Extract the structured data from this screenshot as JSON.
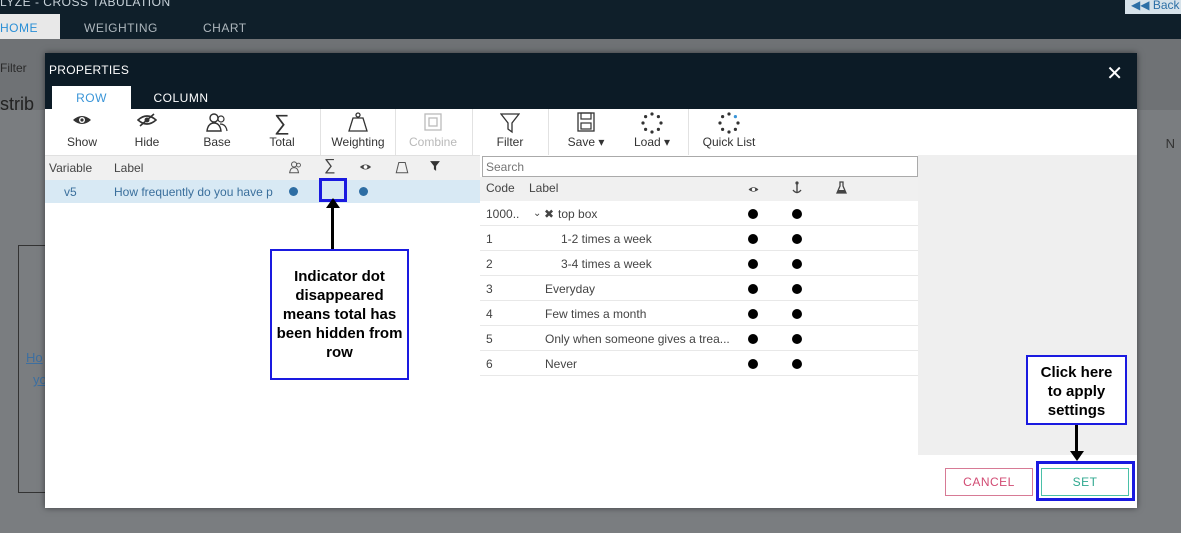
{
  "app": {
    "title": "LYZE - CROSS TABULATION",
    "back_label": "Back",
    "tabs": [
      "HOME",
      "WEIGHTING",
      "CHART"
    ],
    "ribbon_filter_label": "Filter",
    "sheet_text": "strib",
    "sheet_link_1": "Ho",
    "sheet_link_2": "yo",
    "sheet_col_label": "N"
  },
  "modal": {
    "title": "PROPERTIES",
    "close_symbol": "✕",
    "tabs": {
      "row": "ROW",
      "column": "COLUMN"
    },
    "toolbar": {
      "show": "Show",
      "hide": "Hide",
      "base": "Base",
      "total": "Total",
      "weighting": "Weighting",
      "combine": "Combine",
      "filter": "Filter",
      "save": "Save ▾",
      "load": "Load ▾",
      "quick_list": "Quick List"
    },
    "left_table": {
      "headers": {
        "variable": "Variable",
        "label": "Label"
      },
      "row": {
        "variable": "v5",
        "label": "How frequently do you have p"
      }
    },
    "right_table": {
      "search_placeholder": "Search",
      "headers": {
        "code": "Code",
        "label": "Label"
      },
      "rows": [
        {
          "code": "1000..",
          "label": "top box",
          "group": true
        },
        {
          "code": "1",
          "label": "1-2 times a week"
        },
        {
          "code": "2",
          "label": "3-4 times a week"
        },
        {
          "code": "3",
          "label": "Everyday"
        },
        {
          "code": "4",
          "label": "Few times a month"
        },
        {
          "code": "5",
          "label": "Only when someone gives a trea..."
        },
        {
          "code": "6",
          "label": "Never"
        }
      ]
    },
    "buttons": {
      "cancel": "CANCEL",
      "set": "SET"
    }
  },
  "annotations": {
    "indicator_note": "Indicator dot disappeared means total has been hidden from row",
    "apply_note": "Click here to apply settings"
  }
}
